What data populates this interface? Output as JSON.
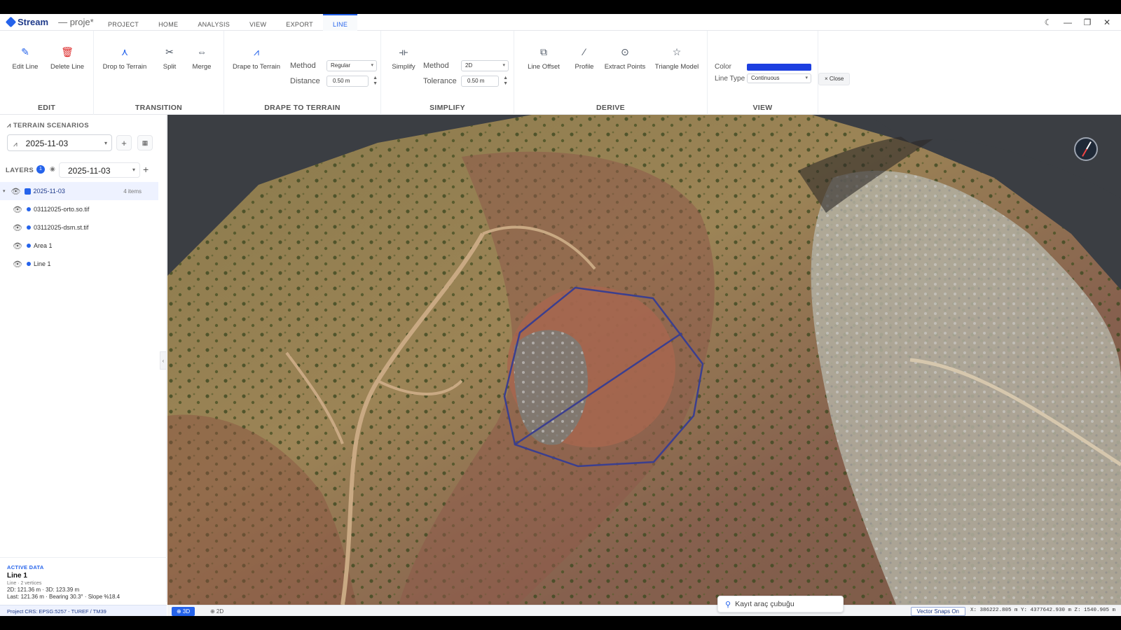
{
  "app": {
    "brand": "Stream",
    "project": "— proje*"
  },
  "tabs": [
    {
      "label": "PROJECT"
    },
    {
      "label": "HOME"
    },
    {
      "label": "ANALYSIS"
    },
    {
      "label": "VIEW"
    },
    {
      "label": "EXPORT"
    },
    {
      "label": "LINE",
      "active": true
    }
  ],
  "window_controls": {
    "theme": "☾",
    "minimize": "—",
    "restore": "❐",
    "close": "✕"
  },
  "ribbon": {
    "edit": {
      "title": "EDIT",
      "edit_line": "Edit Line",
      "delete_line": "Delete Line"
    },
    "transition": {
      "title": "TRANSITION",
      "drop_to_terrain": "Drop to Terrain",
      "split": "Split",
      "merge": "Merge"
    },
    "drape": {
      "title": "DRAPE TO TERRAIN",
      "drape_button": "Drape to Terrain",
      "method_label": "Method",
      "method_value": "Regular",
      "distance_label": "Distance",
      "distance_value": "0.50 m"
    },
    "simplify": {
      "title": "SIMPLIFY",
      "simplify_button": "Simplify",
      "method_label": "Method",
      "method_value": "2D",
      "tolerance_label": "Tolerance",
      "tolerance_value": "0.50 m"
    },
    "derive": {
      "title": "DERIVE",
      "line_offset": "Line Offset",
      "profile": "Profile",
      "extract_points": "Extract Points",
      "triangle_model": "Triangle Model"
    },
    "view": {
      "title": "VIEW",
      "color_label": "Color",
      "color_value": "#1d3fe0",
      "linetype_label": "Line Type",
      "linetype_value": "Continuous",
      "close_label": "× Close"
    }
  },
  "sidebar": {
    "terrain_title": "TERRAIN SCENARIOS",
    "terrain_value": "2025-11-03",
    "layers_title": "LAYERS",
    "layers_badge": "1",
    "layers_value": "2025-11-03",
    "group": {
      "name": "2025-11-03",
      "count": "4 items"
    },
    "items": [
      {
        "name": "03112025-orto.so.tif"
      },
      {
        "name": "03112025-dsm.st.tif"
      },
      {
        "name": "Area 1"
      },
      {
        "name": "Line 1"
      }
    ],
    "active": {
      "header": "ACTIVE DATA",
      "name": "Line 1",
      "sub": "Line · 2 vertices",
      "line1": "2D: 121.36 m · 3D: 123.39 m",
      "line2": "Last: 121.36 m · Bearing 30.3° · Slope %18.4"
    },
    "crs": "Project CRS: EPSG:5257 - TUREF / TM39"
  },
  "statusbar": {
    "view3d": "⊕ 3D",
    "view2d": "⊕ 2D",
    "kayit": "Kayıt araç çubuğu",
    "snap": "Vector Snaps On",
    "coords": "X: 386222.805 m  Y: 4377642.930 m  Z: 1540.905 m"
  },
  "colors": {
    "accent": "#2563eb",
    "polygon": "#3b3f8f"
  }
}
